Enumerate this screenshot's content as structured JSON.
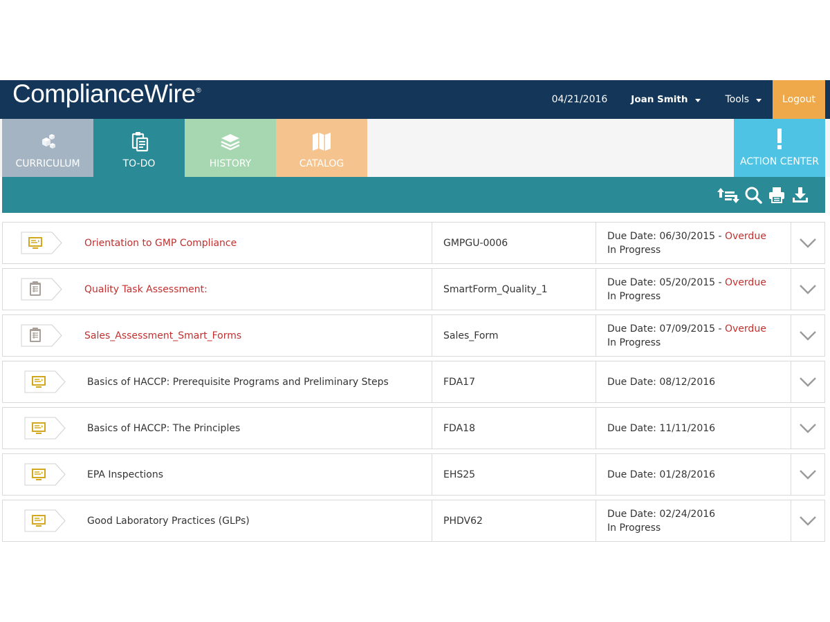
{
  "header": {
    "logo_text": "ComplianceWire",
    "logo_mark": "®",
    "date": "04/21/2016",
    "user_name": "Joan Smith",
    "tools_label": "Tools",
    "logout_label": "Logout"
  },
  "tabs": [
    {
      "label": "CURRICULUM",
      "icon": "cubes-icon"
    },
    {
      "label": "TO-DO",
      "icon": "clipboard-icon",
      "active": true
    },
    {
      "label": "HISTORY",
      "icon": "layers-icon"
    },
    {
      "label": "CATALOG",
      "icon": "map-icon"
    }
  ],
  "action_center": {
    "label": "ACTION CENTER",
    "icon": "exclamation-icon"
  },
  "toolbar": {
    "icons": [
      "sort-icon",
      "search-icon",
      "print-icon",
      "download-icon"
    ]
  },
  "items": [
    {
      "title": "Orientation to GMP Compliance",
      "code": "GMPGU-0006",
      "due": "Due Date: 06/30/2015",
      "overdue": "Overdue",
      "status": "In Progress",
      "icon": "computer-course-icon",
      "overdue_flag": true
    },
    {
      "title": "Quality Task Assessment:",
      "code": "SmartForm_Quality_1",
      "due": "Due Date: 05/20/2015",
      "overdue": "Overdue",
      "status": "In Progress",
      "icon": "form-icon",
      "overdue_flag": true
    },
    {
      "title": "Sales_Assessment_Smart_Forms",
      "code": "Sales_Form",
      "due": "Due Date: 07/09/2015",
      "overdue": "Overdue",
      "status": "In Progress",
      "icon": "form-icon",
      "overdue_flag": true
    },
    {
      "title": "Basics of HACCP: Prerequisite Programs and Preliminary Steps",
      "code": "FDA17",
      "due": "Due Date: 08/12/2016",
      "overdue": "",
      "status": "",
      "icon": "computer-course-icon",
      "overdue_flag": false
    },
    {
      "title": "Basics of HACCP: The Principles",
      "code": "FDA18",
      "due": "Due Date: 11/11/2016",
      "overdue": "",
      "status": "",
      "icon": "computer-course-icon",
      "overdue_flag": false
    },
    {
      "title": "EPA Inspections",
      "code": "EHS25",
      "due": "Due Date: 01/28/2016",
      "overdue": "",
      "status": "",
      "icon": "computer-course-icon",
      "overdue_flag": false
    },
    {
      "title": "Good Laboratory Practices (GLPs)",
      "code": "PHDV62",
      "due": "Due Date: 02/24/2016",
      "overdue": "",
      "status": "In Progress",
      "icon": "computer-course-icon",
      "overdue_flag": false
    }
  ],
  "colors": {
    "header_bg": "#143658",
    "accent_teal": "#2a8b97",
    "logout_orange": "#f0a94a",
    "overdue_red": "#c0302f",
    "course_icon_gold": "#d4a81e"
  }
}
